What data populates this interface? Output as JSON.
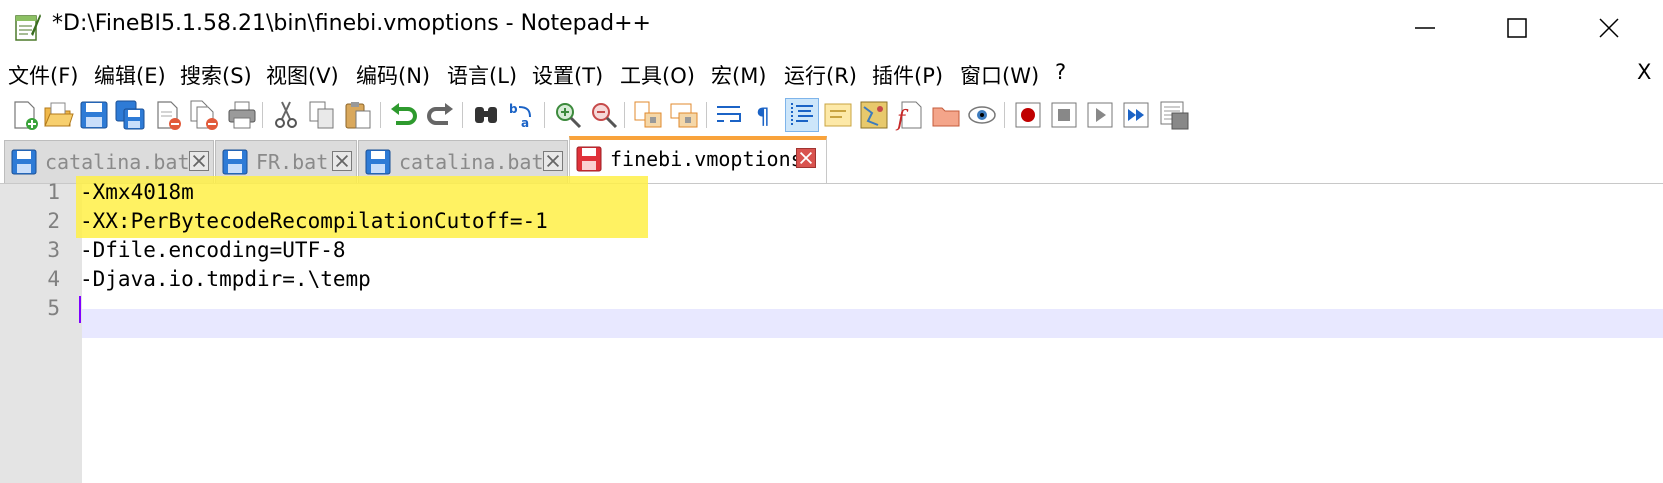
{
  "window": {
    "title": "*D:\\FineBI5.1.58.21\\bin\\finebi.vmoptions - Notepad++",
    "app_icon": "notepad-plus-plus-icon"
  },
  "menubar": {
    "items": [
      {
        "label": "文件(F)"
      },
      {
        "label": "编辑(E)"
      },
      {
        "label": "搜索(S)"
      },
      {
        "label": "视图(V)"
      },
      {
        "label": "编码(N)"
      },
      {
        "label": "语言(L)"
      },
      {
        "label": "设置(T)"
      },
      {
        "label": "工具(O)"
      },
      {
        "label": "宏(M)"
      },
      {
        "label": "运行(R)"
      },
      {
        "label": "插件(P)"
      },
      {
        "label": "窗口(W)"
      },
      {
        "label": "?"
      }
    ],
    "close_label": "X"
  },
  "toolbar": {
    "icons": [
      "new-file-icon",
      "open-file-icon",
      "save-icon",
      "save-all-icon",
      "close-icon",
      "close-all-icon",
      "print-icon",
      "cut-icon",
      "copy-icon",
      "paste-icon",
      "undo-icon",
      "redo-icon",
      "find-icon",
      "replace-icon",
      "zoom-in-icon",
      "zoom-out-icon",
      "sync-vertical-icon",
      "sync-horizontal-icon",
      "word-wrap-icon",
      "show-all-characters-icon",
      "indent-guide-icon",
      "language-udl-icon",
      "document-map-icon",
      "function-list-icon",
      "folder-as-workspace-icon",
      "monitoring-icon",
      "record-macro-icon",
      "stop-recording-icon",
      "play-macro-icon",
      "run-macro-multiple-icon",
      "save-macro-icon"
    ]
  },
  "tabs": [
    {
      "label": "catalina.bat",
      "active": false,
      "modified": false
    },
    {
      "label": "FR.bat",
      "active": false,
      "modified": false
    },
    {
      "label": "catalina.bat",
      "active": false,
      "modified": false
    },
    {
      "label": "finebi.vmoptions",
      "active": true,
      "modified": true
    }
  ],
  "editor": {
    "lines": [
      {
        "number": "1",
        "text": "-Xmx4018m"
      },
      {
        "number": "2",
        "text": "-XX:PerBytecodeRecompilationCutoff=-1"
      },
      {
        "number": "3",
        "text": "-Dfile.encoding=UTF-8"
      },
      {
        "number": "4",
        "text": "-Djava.io.tmpdir=.\\temp"
      },
      {
        "number": "5",
        "text": ""
      }
    ],
    "current_line": "5",
    "highlight_color": "#fff046",
    "current_line_color": "#e8e8ff",
    "caret_color": "#8000ff"
  },
  "colors": {
    "active_tab_accent": "#f9a33b",
    "gutter_bg": "#e4e4e4"
  }
}
